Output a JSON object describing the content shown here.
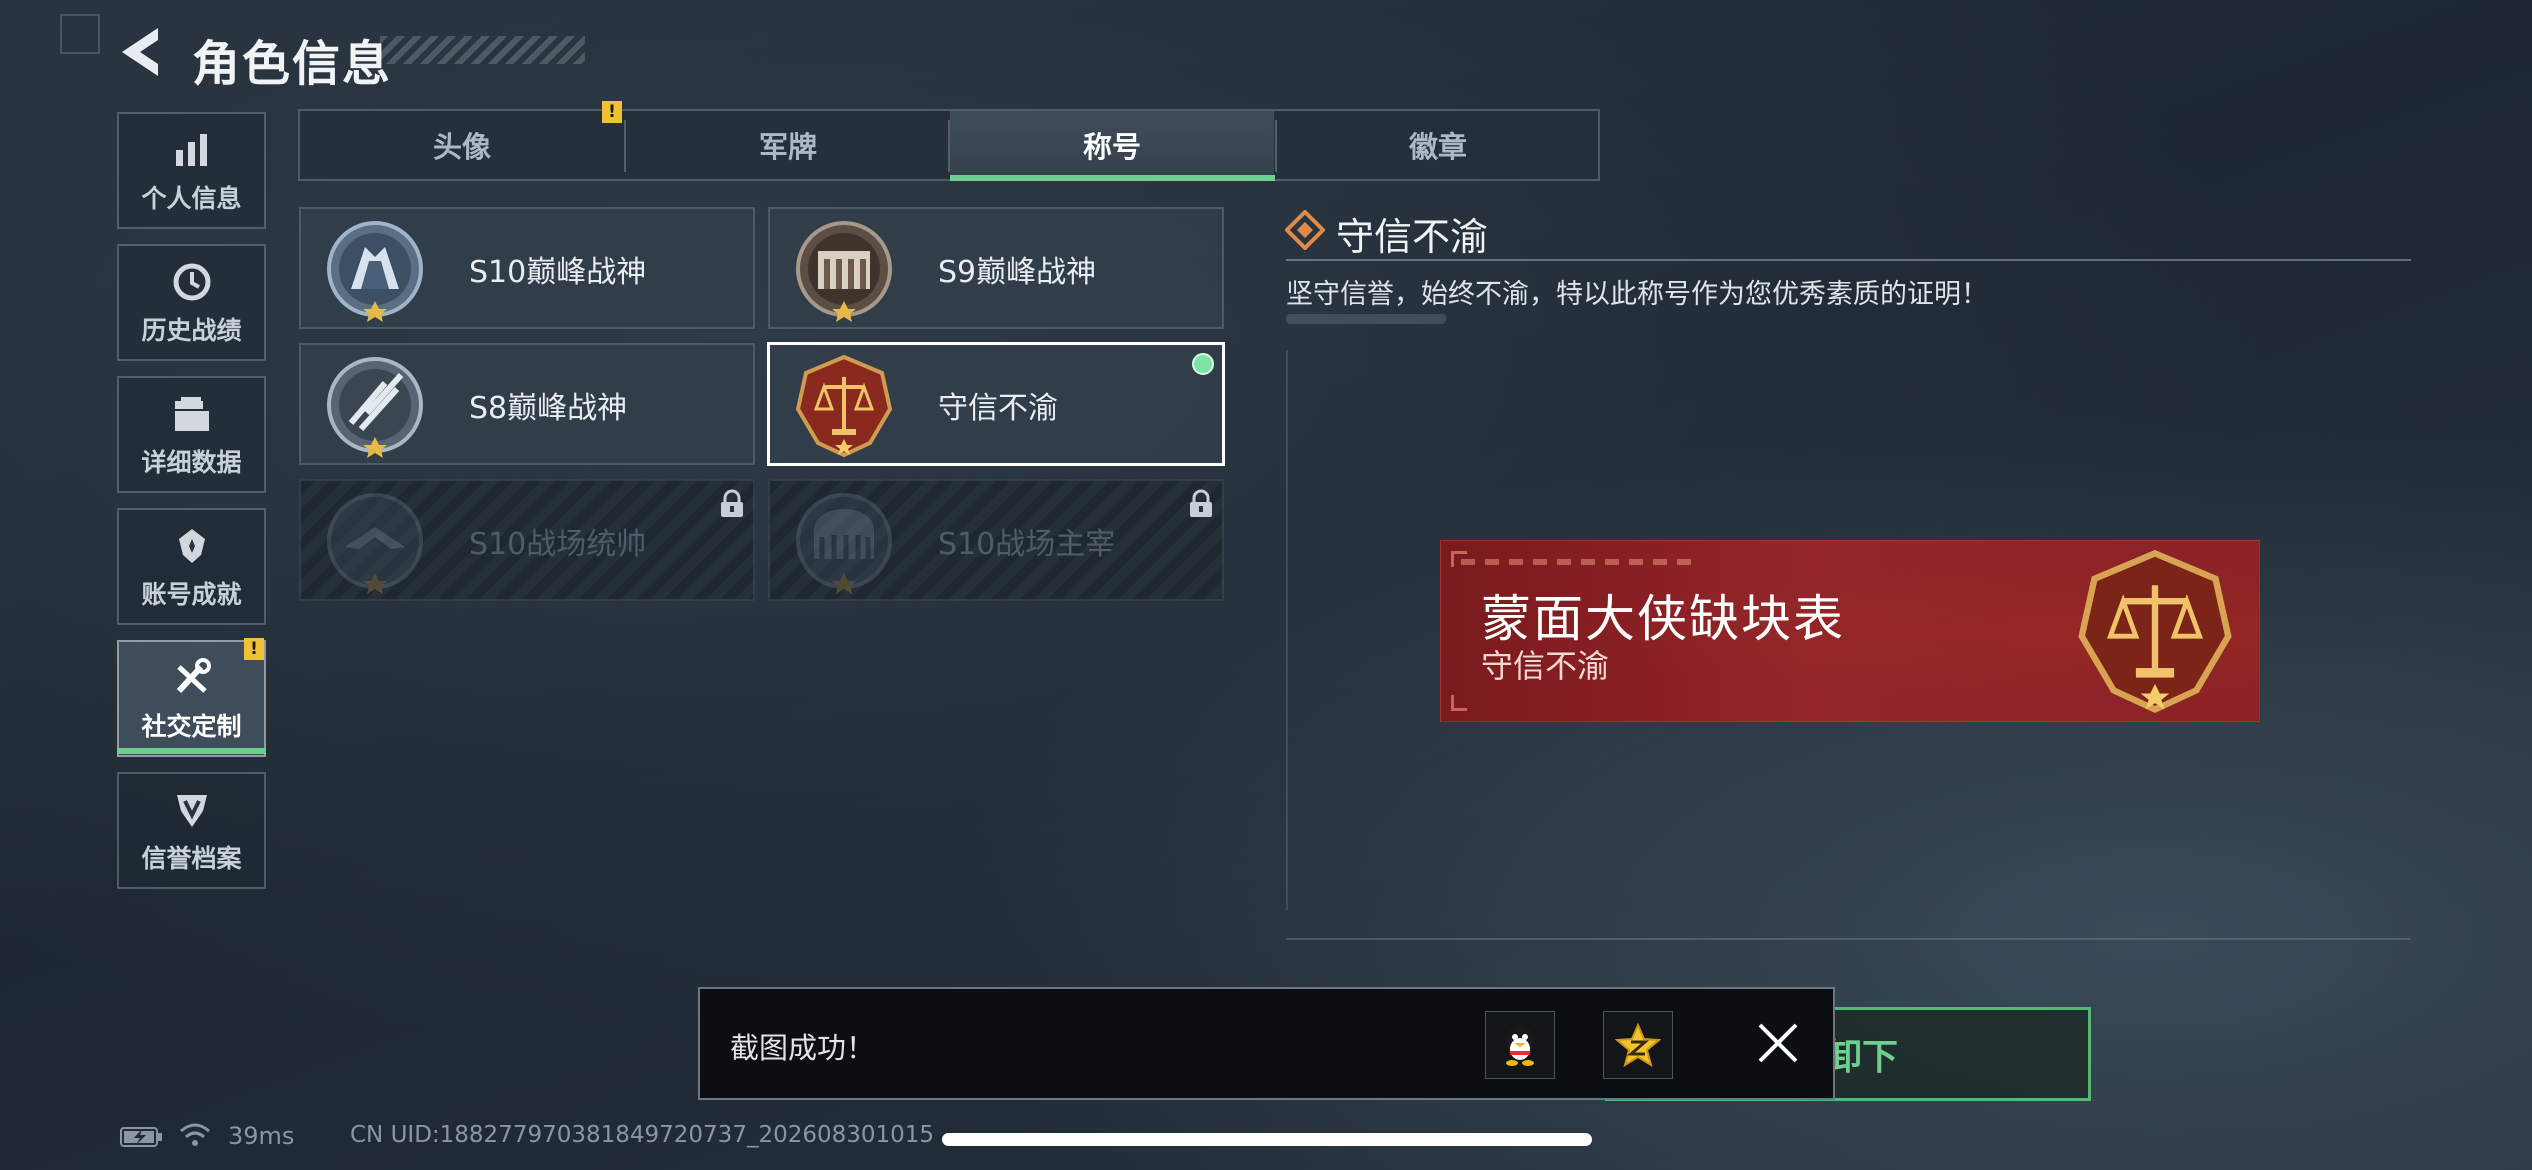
{
  "header": {
    "title": "角色信息"
  },
  "nav": {
    "items": [
      {
        "label": "个人信息",
        "icon": "bar-chart-icon"
      },
      {
        "label": "历史战绩",
        "icon": "history-clock-icon"
      },
      {
        "label": "详细数据",
        "icon": "folder-icon"
      },
      {
        "label": "账号成就",
        "icon": "achievement-icon"
      },
      {
        "label": "社交定制",
        "icon": "tools-icon",
        "active": true,
        "badge": "!"
      },
      {
        "label": "信誉档案",
        "icon": "credit-shield-icon"
      }
    ]
  },
  "tabs": [
    {
      "label": "头像",
      "badge": "!"
    },
    {
      "label": "军牌"
    },
    {
      "label": "称号",
      "active": true
    },
    {
      "label": "徽章"
    }
  ],
  "titles": [
    {
      "label": "S10巅峰战神",
      "locked": false
    },
    {
      "label": "S9巅峰战神",
      "locked": false
    },
    {
      "label": "S8巅峰战神",
      "locked": false
    },
    {
      "label": "守信不渝",
      "locked": false,
      "selected": true,
      "equipped": true
    },
    {
      "label": "S10战场统帅",
      "locked": true
    },
    {
      "label": "S10战场主宰",
      "locked": true
    }
  ],
  "detail": {
    "title": "守信不渝",
    "description": "坚守信誉，始终不渝，特以此称号作为您优秀素质的证明！"
  },
  "banner": {
    "player_name": "蒙面大侠缺块表",
    "title": "守信不渝"
  },
  "unequip_button": {
    "label": "卸下"
  },
  "toast": {
    "message": "截图成功！",
    "share_targets": [
      "qq-penguin-icon",
      "qzone-star-icon"
    ]
  },
  "status": {
    "ping": "39ms",
    "uid": "CN UID:188277970381849720737_202608301015"
  },
  "colors": {
    "accent_green": "#6fcf8f",
    "warning_yellow": "#f0c232",
    "banner_red": "#93252a"
  }
}
